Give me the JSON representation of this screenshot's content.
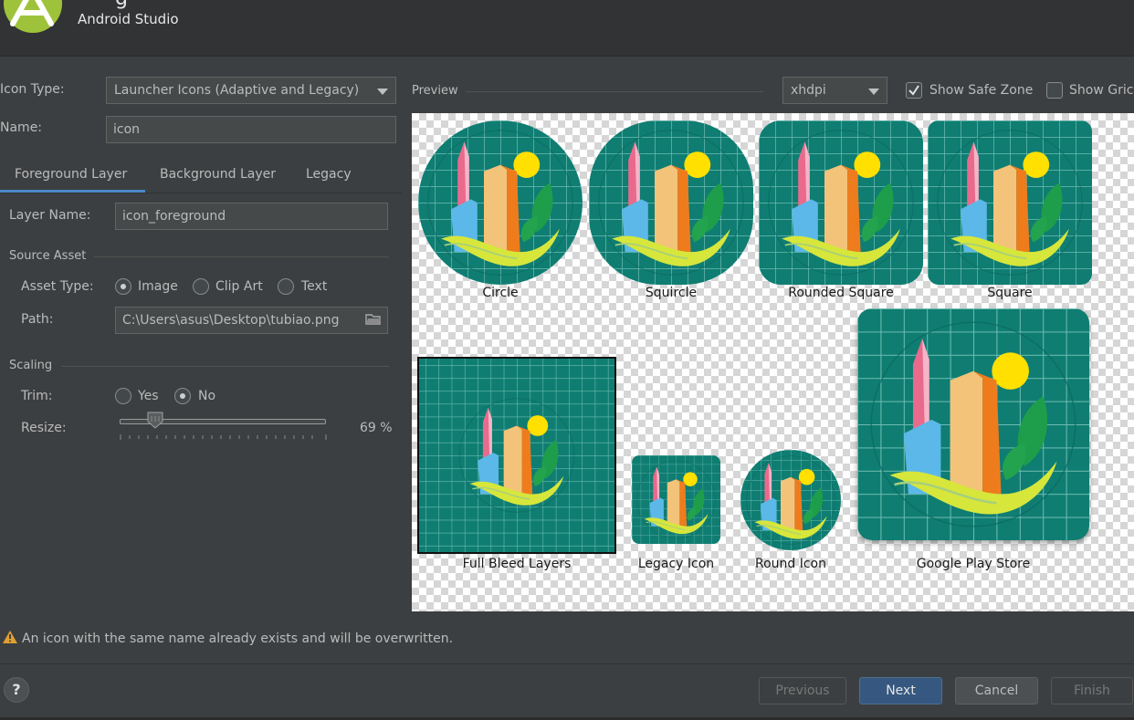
{
  "header": {
    "title_fragment": "g",
    "subtitle": "Android Studio"
  },
  "form": {
    "icon_type_label": "Icon Type:",
    "icon_type_value": "Launcher Icons (Adaptive and Legacy)",
    "name_label": "Name:",
    "name_value": "icon"
  },
  "tabs": {
    "foreground": "Foreground Layer",
    "background": "Background Layer",
    "legacy": "Legacy",
    "selected": "Foreground Layer"
  },
  "layer": {
    "layer_name_label": "Layer Name:",
    "layer_name_value": "icon_foreground",
    "source_asset_title": "Source Asset",
    "asset_type_label": "Asset Type:",
    "asset_options": [
      "Image",
      "Clip Art",
      "Text"
    ],
    "asset_selected": "Image",
    "path_label": "Path:",
    "path_value": "C:\\Users\\asus\\Desktop\\tubiao.png",
    "scaling_title": "Scaling",
    "trim_label": "Trim:",
    "trim_options": [
      "Yes",
      "No"
    ],
    "trim_selected": "No",
    "resize_label": "Resize:",
    "resize_value": "69 %",
    "resize_percent": 69
  },
  "preview": {
    "label": "Preview",
    "density_value": "xhdpi",
    "show_safe_zone_label": "Show Safe Zone",
    "show_safe_zone_checked": true,
    "show_grid_label": "Show Gric",
    "show_grid_checked": false,
    "captions": {
      "circle": "Circle",
      "squircle": "Squircle",
      "rounded_square": "Rounded Square",
      "square": "Square",
      "full_bleed": "Full Bleed Layers",
      "legacy": "Legacy Icon",
      "round": "Round Icon",
      "play_store": "Google Play Store"
    }
  },
  "footer": {
    "warning": "An icon with the same name already exists and will be overwritten.",
    "help": "?",
    "previous": "Previous",
    "next": "Next",
    "cancel": "Cancel",
    "finish": "Finish"
  },
  "colors": {
    "icon_bg": "#0f7d72",
    "accent": "#4a88c7"
  }
}
